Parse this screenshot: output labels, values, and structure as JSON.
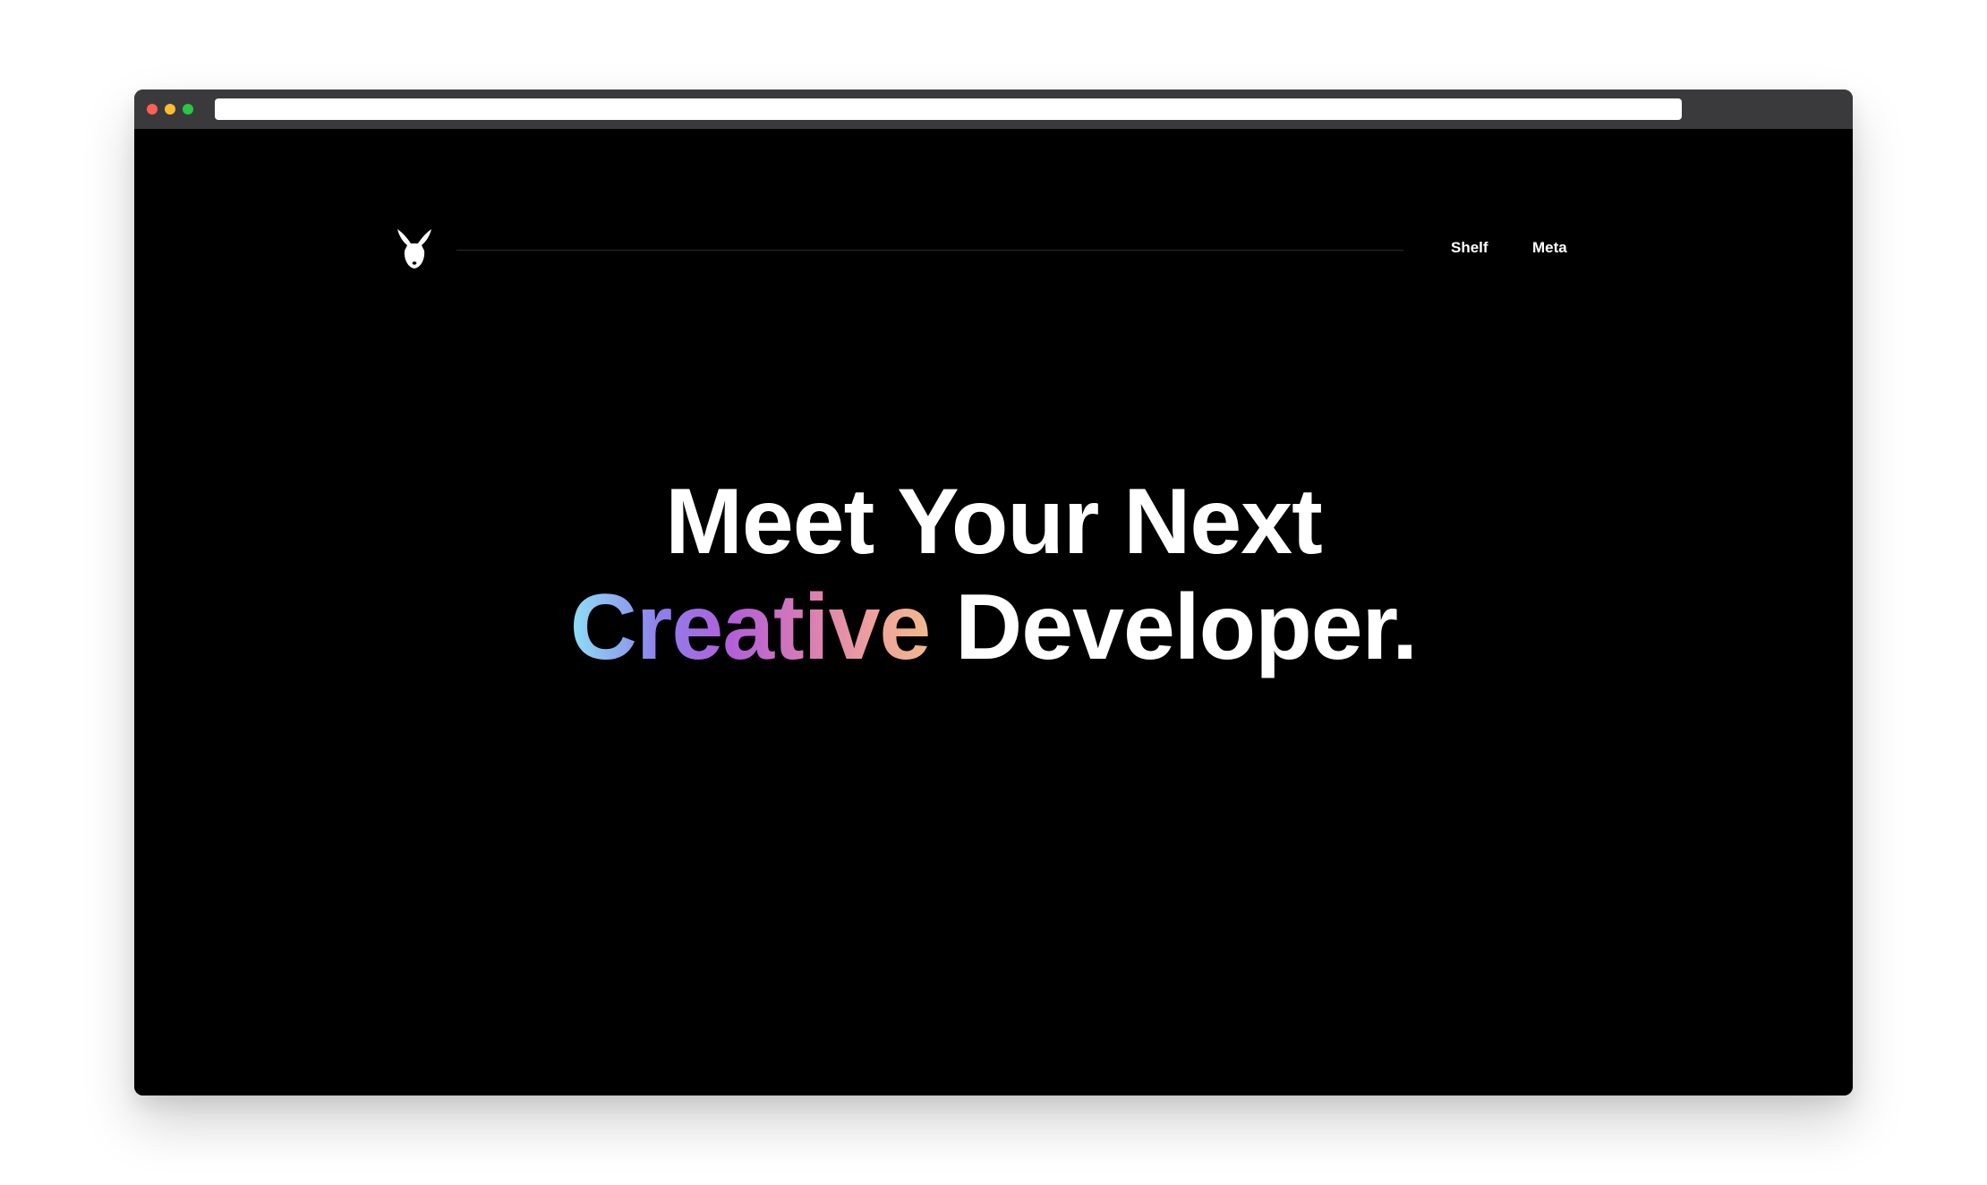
{
  "browser": {
    "url": ""
  },
  "nav": {
    "logo_icon": "rabbit-head-icon",
    "links": [
      {
        "label": "Shelf"
      },
      {
        "label": "Meta"
      }
    ]
  },
  "hero": {
    "line1": "Meet Your Next",
    "highlight": "Creative",
    "line2_rest": " Developer."
  },
  "colors": {
    "background": "#000000",
    "text": "#ffffff",
    "gradient_start": "#8fe0f5",
    "gradient_mid": "#b35fd9",
    "gradient_end": "#f0b98e"
  }
}
